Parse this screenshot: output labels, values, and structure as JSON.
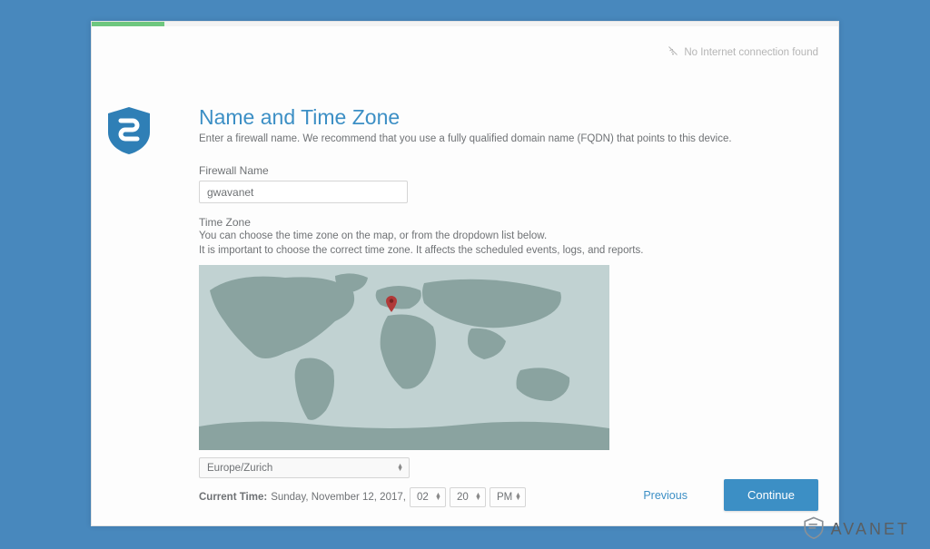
{
  "status": {
    "no_internet": "No Internet connection found"
  },
  "page": {
    "title": "Name and Time Zone",
    "subtitle": "Enter a firewall name. We recommend that you use a fully qualified domain name (FQDN) that points to this device."
  },
  "firewall": {
    "label": "Firewall Name",
    "value": "gwavanet"
  },
  "timezone": {
    "label": "Time Zone",
    "desc1": "You can choose the time zone on the map, or from the dropdown list below.",
    "desc2": "It is important to choose the correct time zone. It affects the scheduled events, logs, and reports.",
    "selected": "Europe/Zurich"
  },
  "time": {
    "label": "Current Time:",
    "date": "Sunday, November 12, 2017,",
    "hour": "02",
    "minute": "20",
    "ampm": "PM"
  },
  "footer": {
    "previous": "Previous",
    "continue": "Continue"
  },
  "brand": {
    "name": "AVANET"
  }
}
